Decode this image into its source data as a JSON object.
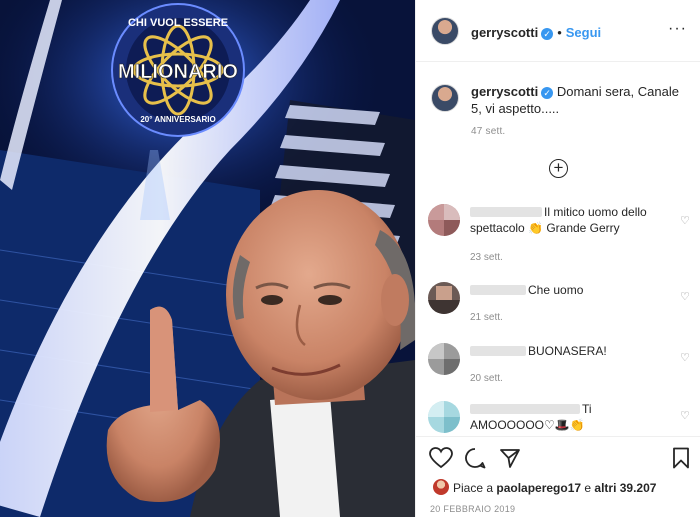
{
  "post": {
    "username": "gerryscotti",
    "follow_label": "Segui",
    "more_label": "···",
    "logo": {
      "line1": "CHI VUOL ESSERE",
      "line2": "MILIONARIO",
      "line3": "20° ANNIVERSARIO"
    }
  },
  "caption": {
    "username": "gerryscotti",
    "text": "Domani sera, Canale 5, vi aspetto.....",
    "time": "47 sett."
  },
  "comments": [
    {
      "text": "Il mitico uomo dello spettacolo 👏 Grande Gerry",
      "time": "23 sett."
    },
    {
      "text": "Che uomo",
      "time": "21 sett."
    },
    {
      "text": "BUONASERA!",
      "time": "20 sett."
    },
    {
      "text": "Ti AMOOOOOO♡🎩👏",
      "time": ""
    }
  ],
  "likes": {
    "prefix": "Piace a ",
    "user": "paolaperego17",
    "middle": " e ",
    "others": "altri 39.207"
  },
  "date": "20 FEBBRAIO 2019",
  "colors": {
    "link": "#3897f0",
    "muted": "#8e8e8e",
    "text": "#262626"
  },
  "icons": [
    "verified-icon",
    "more-icon",
    "load-more-icon",
    "heart-icon",
    "comment-icon",
    "share-icon",
    "bookmark-icon"
  ]
}
